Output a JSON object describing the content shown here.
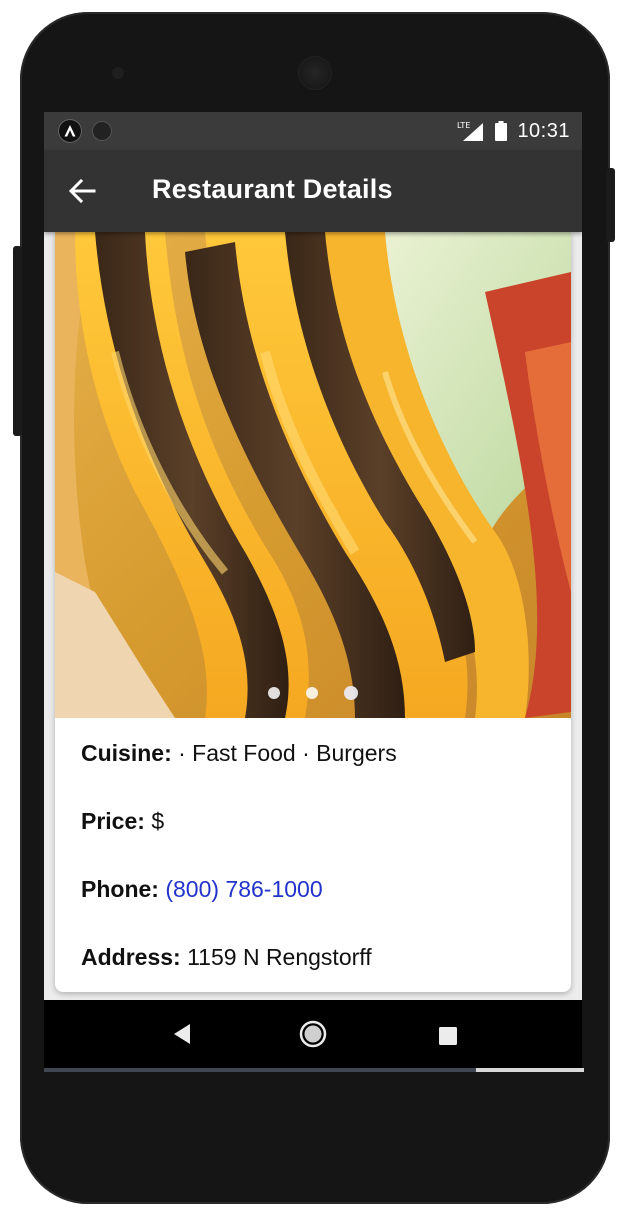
{
  "status_bar": {
    "time": "10:31",
    "network_icon": "lte-signal-icon",
    "battery_icon": "battery-icon"
  },
  "app_bar": {
    "title": "Restaurant Details",
    "back_icon": "arrow-back-icon"
  },
  "carousel": {
    "image": "burger-photo",
    "dot_count": 3,
    "active_index": 2
  },
  "details": {
    "cuisine": {
      "label": "Cuisine:",
      "value": " · Fast Food · Burgers"
    },
    "price": {
      "label": "Price:",
      "value": " $"
    },
    "phone": {
      "label": "Phone:",
      "value": " (800) 786-1000"
    },
    "address": {
      "label": "Address:",
      "value": " 1159 N Rengstorff"
    }
  },
  "colors": {
    "app_bar": "#333333",
    "status_bar": "#3b3b3b",
    "phone_link": "#2233cc"
  },
  "nav_bar": {
    "back_icon": "triangle-back-icon",
    "home_icon": "circle-home-icon",
    "recent_icon": "square-recents-icon"
  }
}
